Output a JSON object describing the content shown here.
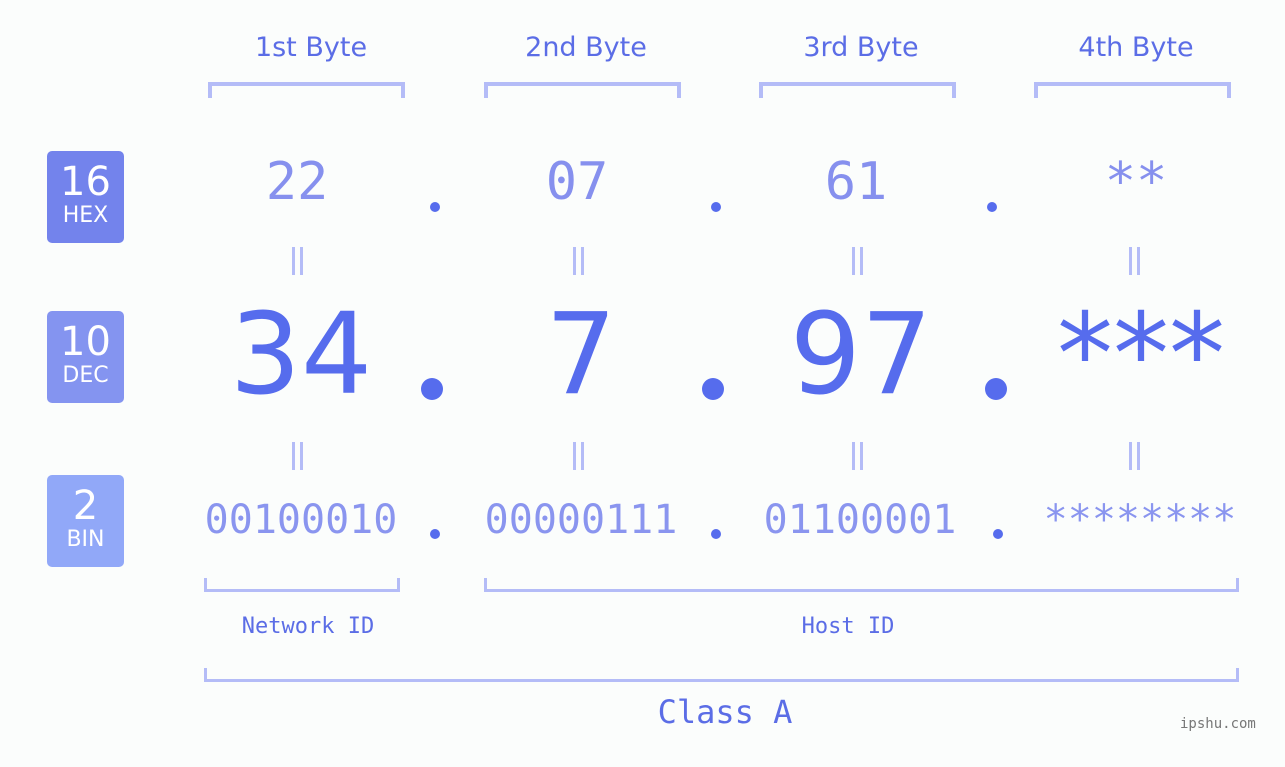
{
  "colors": {
    "hex_badge": "#7383ec",
    "dec_badge": "#8494f0",
    "bin_badge": "#91a8f8",
    "accent": "#566ced",
    "bracket": "#b4bcf7"
  },
  "badges": [
    {
      "number": "16",
      "label": "HEX"
    },
    {
      "number": "10",
      "label": "DEC"
    },
    {
      "number": "2",
      "label": "BIN"
    }
  ],
  "byte_titles": [
    "1st Byte",
    "2nd Byte",
    "3rd Byte",
    "4th Byte"
  ],
  "hex_values": [
    "22",
    "07",
    "61",
    "**"
  ],
  "dec_values": [
    "34",
    "7",
    "97",
    "***"
  ],
  "bin_values": [
    "00100010",
    "00000111",
    "01100001",
    "********"
  ],
  "separator": ".",
  "network_id_label": "Network ID",
  "host_id_label": "Host ID",
  "class_label": "Class A",
  "watermark": "ipshu.com"
}
